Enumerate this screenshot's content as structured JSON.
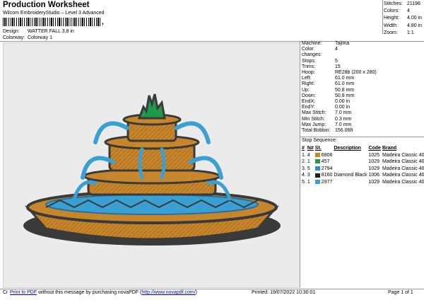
{
  "header": {
    "title": "Production Worksheet",
    "subtitle": "Wilcom EmbroideryStudio – Level 3 Advanced"
  },
  "design": {
    "design_label": "Design:",
    "design_value": "WATTER FALL 3,8 in",
    "colorway_label": "Colorway:",
    "colorway_value": "Colorway 1"
  },
  "stats": [
    {
      "label": "Stitches:",
      "value": "21196"
    },
    {
      "label": "Colors:",
      "value": "4"
    },
    {
      "label": "Height:",
      "value": "4.00 in"
    },
    {
      "label": "Width:",
      "value": "4.80 in"
    },
    {
      "label": "Zoom:",
      "value": "1:1"
    }
  ],
  "machine": [
    {
      "label": "Machine:",
      "value": "Tajima"
    },
    {
      "label": "Color changes:",
      "value": "4"
    },
    {
      "label": "Stops:",
      "value": "5"
    },
    {
      "label": "Trims:",
      "value": "15"
    },
    {
      "label": "Hoop:",
      "value": "RE28b (200 x 280)"
    },
    {
      "label": "Left:",
      "value": "61.0 mm"
    },
    {
      "label": "Right:",
      "value": "61.0 mm"
    },
    {
      "label": "Up:",
      "value": "50.8 mm"
    },
    {
      "label": "Down:",
      "value": "50.8 mm"
    },
    {
      "label": "EndX:",
      "value": "0.00 in"
    },
    {
      "label": "EndY:",
      "value": "0.00 in"
    },
    {
      "label": "Max Stitch:",
      "value": "7.0 mm"
    },
    {
      "label": "Min Stitch:",
      "value": "0.3 mm"
    },
    {
      "label": "Max Jump:",
      "value": "7.0 mm"
    },
    {
      "label": "Total Bobbin:",
      "value": "156.06ft"
    }
  ],
  "stop_sequence": {
    "title": "Stop Sequence:",
    "headers": [
      "#",
      "N#",
      "St.",
      "Description",
      "Code",
      "Brand"
    ],
    "rows": [
      {
        "num": "1.",
        "n": "4",
        "st": "6806",
        "desc": "",
        "code": "1025",
        "brand": "Madeira Classic 40",
        "color": "#c8862c"
      },
      {
        "num": "2.",
        "n": "1",
        "st": "457",
        "desc": "",
        "code": "1029",
        "brand": "Madeira Classic 40",
        "color": "#1f9a4a"
      },
      {
        "num": "3.",
        "n": "5",
        "st": "2794",
        "desc": "",
        "code": "1029",
        "brand": "Madeira Classic 40",
        "color": "#2c8fc4"
      },
      {
        "num": "4.",
        "n": "3",
        "st": "8160",
        "desc": "Diamond Black",
        "code": "1006",
        "brand": "Madeira Classic 40",
        "color": "#1e1e1e"
      },
      {
        "num": "5.",
        "n": "1",
        "st": "2977",
        "desc": "",
        "code": "1029",
        "brand": "Madeira Classic 40",
        "color": "#3aa0d4"
      }
    ]
  },
  "footer": {
    "cr": "Cr",
    "link": "Print to PDF",
    "message": " without this message by purchasing novaPDF (",
    "url": "http://www.novapdf.com/",
    "close": ")",
    "printed": "Printed:  19/07/2022 10:30:01",
    "page": "Page 1 of 1"
  }
}
